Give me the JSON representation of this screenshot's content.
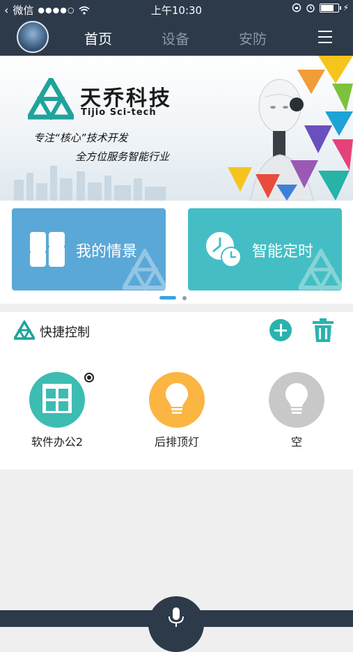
{
  "status_bar": {
    "carrier": "微信",
    "signal": "●●●●○",
    "time": "上午10:30"
  },
  "nav": {
    "tabs": [
      {
        "label": "首页",
        "active": true
      },
      {
        "label": "设备",
        "active": false
      },
      {
        "label": "安防",
        "active": false
      }
    ]
  },
  "banner": {
    "brand_name": "天乔科技",
    "brand_en": "Tijio Sci-tech",
    "slogan_line1": "专注“核心”技术开发",
    "slogan_line2": "全方位服务智能行业"
  },
  "cards": [
    {
      "label": "我的情景",
      "color": "#5aa8d7",
      "icon": "scene-grid-icon"
    },
    {
      "label": "智能定时",
      "color": "#44bec4",
      "icon": "clock-icon"
    }
  ],
  "pager": {
    "pages": 2,
    "current": 1
  },
  "quick_control": {
    "title": "快捷控制",
    "devices": [
      {
        "name": "软件办公2",
        "type": "window",
        "color": "#3dbcb2",
        "badge": true
      },
      {
        "name": "后排顶灯",
        "type": "bulb",
        "color": "#fbb543",
        "badge": false
      },
      {
        "name": "空",
        "type": "bulb",
        "color": "#c8c8c8",
        "badge": false
      }
    ]
  },
  "colors": {
    "nav_bg": "#2d3a4a",
    "accent_teal": "#2ab3ae",
    "pager_active": "#3aa5dc"
  }
}
